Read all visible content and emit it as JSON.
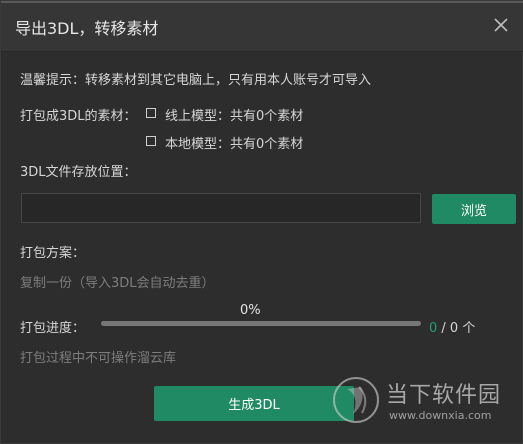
{
  "window": {
    "title": "导出3DL，转移素材"
  },
  "tips": {
    "text": "温馨提示：转移素材到其它电脑上，只有用本人账号才可导入"
  },
  "package_materials": {
    "label": "打包成3DL的素材：",
    "online_model": "线上模型：共有0个素材",
    "local_model": "本地模型：共有0个素材"
  },
  "location": {
    "label": "3DL文件存放位置：",
    "path_value": "",
    "browse_label": "浏览"
  },
  "plan": {
    "label": "打包方案：",
    "option": "复制一份（导入3DL会自动去重）"
  },
  "progress": {
    "label": "打包进度：",
    "percent_text": "0%",
    "fraction": 0,
    "current": "0",
    "total_text": "/ 0 个"
  },
  "note": {
    "text": "打包过程中不可操作溜云库"
  },
  "actions": {
    "generate_label": "生成3DL"
  },
  "watermark": {
    "name": "当下软件园",
    "url": "www.downxia.com"
  },
  "colors": {
    "accent": "#1f8a63",
    "progress_value": "#1fa06c"
  }
}
